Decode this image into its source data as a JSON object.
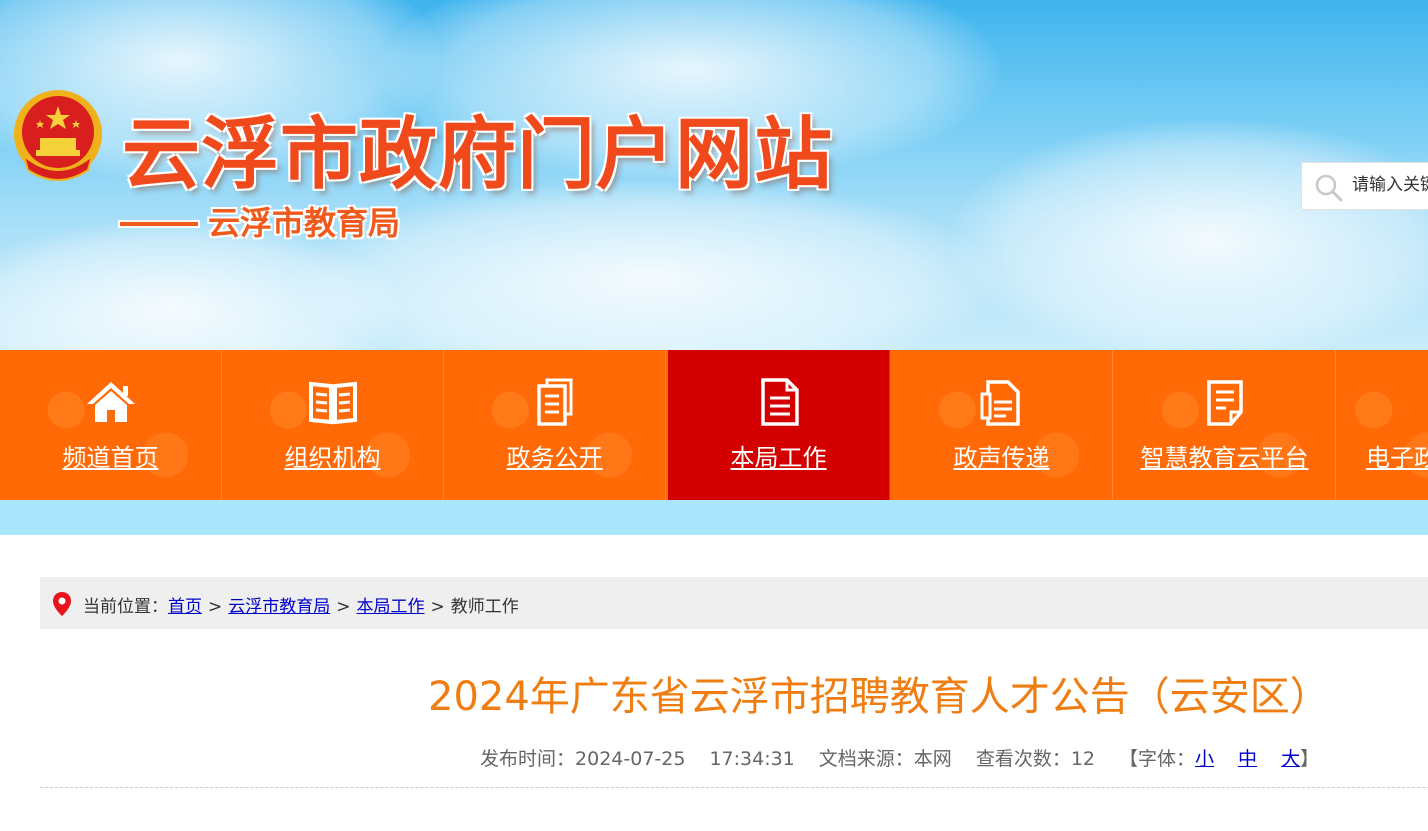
{
  "header": {
    "site_title": "云浮市政府门户网站",
    "sub_title": "云浮市教育局",
    "search_placeholder": "请输入关键词"
  },
  "nav": {
    "items": [
      {
        "label": "频道首页",
        "icon": "home-icon",
        "active": false
      },
      {
        "label": "组织机构",
        "icon": "open-book-icon",
        "active": false
      },
      {
        "label": "政务公开",
        "icon": "documents-icon",
        "active": false
      },
      {
        "label": "本局工作",
        "icon": "document-list-icon",
        "active": true
      },
      {
        "label": "政声传递",
        "icon": "file-text-icon",
        "active": false
      },
      {
        "label": "智慧教育云平台",
        "icon": "file-edit-icon",
        "active": false
      },
      {
        "label": "电子政",
        "icon": "",
        "active": false
      }
    ]
  },
  "breadcrumb": {
    "prefix": "当前位置：",
    "links": [
      "首页",
      "云浮市教育局",
      "本局工作"
    ],
    "separator": ">",
    "current": "教师工作"
  },
  "article": {
    "title": "2024年广东省云浮市招聘教育人才公告（云安区）",
    "publish_label": "发布时间：",
    "publish_date": "2024-07-25",
    "publish_time": "17:34:31",
    "source_label": "文档来源：",
    "source": "本网",
    "views_label": "查看次数：",
    "views": "12",
    "font_label": "【字体：",
    "font_small": "小",
    "font_medium": "中",
    "font_large": "大",
    "font_close": "】"
  },
  "colors": {
    "nav_bg": "#ff6a06",
    "nav_active": "#d40000",
    "title": "#f07d12",
    "brand_red": "#f04a1c"
  }
}
